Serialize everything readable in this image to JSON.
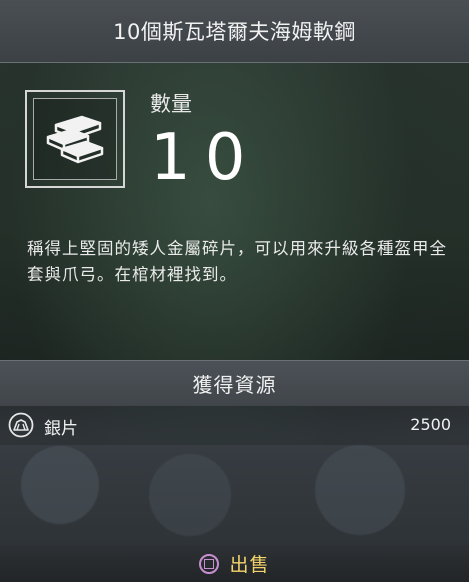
{
  "title": "10個斯瓦塔爾夫海姆軟鋼",
  "item": {
    "icon": "steel-ingots-icon",
    "quantity_label": "數量",
    "quantity_value": "10",
    "description": "稱得上堅固的矮人金屬碎片，可以用來升級各種盔甲全套與爪弓。在棺材裡找到。"
  },
  "resources": {
    "header": "獲得資源",
    "items": [
      {
        "icon": "hacksilver-icon",
        "name": "銀片",
        "value": "2500"
      }
    ]
  },
  "footer": {
    "button_icon": "square-button-icon",
    "action_label": "出售",
    "accent_color": "#f4d46a",
    "button_color": "#c88fd0"
  }
}
